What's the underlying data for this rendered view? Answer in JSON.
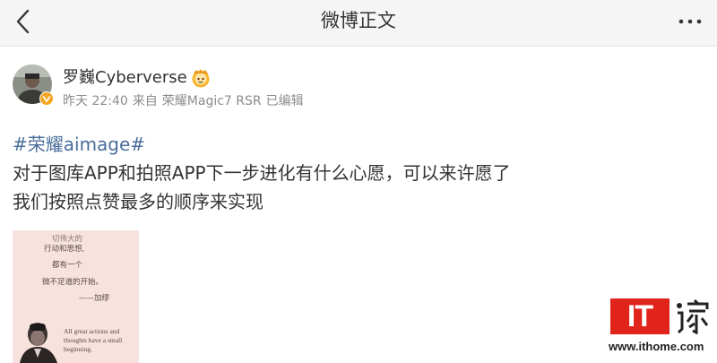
{
  "nav": {
    "title": "微博正文"
  },
  "author": {
    "name": "罗巍Cyberverse"
  },
  "meta": {
    "time": "昨天 22:40",
    "source_prefix": "来自",
    "source": "荣耀Magic7 RSR",
    "edited": "已编辑"
  },
  "post": {
    "hashtag": "#荣耀aimage#",
    "line1": "对于图库APP和拍照APP下一步进化有什么心愿，可以来许愿了",
    "line2": "我们按照点赞最多的顺序来实现"
  },
  "image_text": {
    "line1": "切伟大的",
    "line2": "行动和思想,",
    "line3": "都有一个",
    "line4": "微不足道的开始。",
    "line5": "——加缪",
    "en_line1": "All great actions and",
    "en_line2": "thoughts have a small",
    "en_line3": "beginning."
  },
  "watermark": {
    "brand": "IT",
    "url": "www.ithome.com"
  },
  "colors": {
    "link": "#4a6d9b",
    "meta": "#8c8c8c",
    "text": "#333333",
    "nav_bg": "#f5f5f5",
    "badge_orange": "#f5a623",
    "brand_red": "#e0241b",
    "image_bg": "#f7e2de"
  },
  "icons": {
    "back": "chevron-left-icon",
    "more": "more-dots-icon",
    "verified": "verified-badge-icon",
    "member": "crown-badge-icon"
  }
}
